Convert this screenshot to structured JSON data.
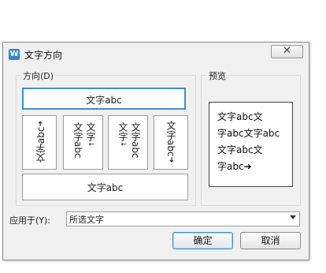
{
  "window": {
    "title": "文字方向",
    "app_icon": "W",
    "close_glyph": "✕"
  },
  "direction_group": {
    "label": "方向(D)",
    "options": [
      {
        "name": "horizontal",
        "text": "文字abc"
      },
      {
        "name": "vertical-rotated-left",
        "text": "文字abc"
      },
      {
        "name": "vertical-stacked",
        "col1": "文字abc",
        "col2": "文字"
      },
      {
        "name": "vertical-stacked-rtl",
        "col1": "文字abc",
        "col2": "文字"
      },
      {
        "name": "vertical-rotated-right",
        "text": "文字abc"
      },
      {
        "name": "horizontal-upside-down",
        "text": "文字abc"
      }
    ]
  },
  "preview_group": {
    "label": "预览",
    "lines": [
      "文字abc文",
      "字abc文字abc",
      "文字abc文",
      "字abc➜"
    ]
  },
  "apply": {
    "label": "应用于(Y):",
    "value": "所选文字"
  },
  "buttons": {
    "ok": "确定",
    "cancel": "取消"
  }
}
